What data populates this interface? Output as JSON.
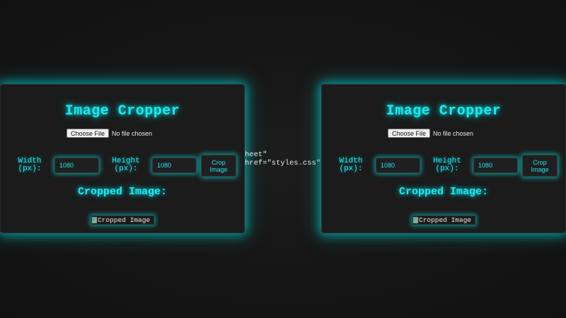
{
  "panels": [
    {
      "title": "Image Cropper",
      "file_button": "Choose File",
      "file_status": "No file chosen",
      "width_label_1": "Width",
      "width_label_2": "(px):",
      "width_value": "1080",
      "height_label_1": "Height",
      "height_label_2": "(px):",
      "height_value": "1080",
      "crop_button_1": "Crop",
      "crop_button_2": "Image",
      "subtitle": "Cropped Image:",
      "image_alt": "Cropped Image"
    },
    {
      "title": "Image Cropper",
      "file_button": "Choose File",
      "file_status": "No file chosen",
      "width_label_1": "Width",
      "width_label_2": "(px):",
      "width_value": "1080",
      "height_label_1": "Height",
      "height_label_2": "(px):",
      "height_value": "1080",
      "crop_button_1": "Crop",
      "crop_button_2": "Image",
      "subtitle": "Cropped Image:",
      "image_alt": "Cropped Image"
    }
  ],
  "stray_text": {
    "line1": "heet\"",
    "line2": "href=\"styles.css\">"
  },
  "colors": {
    "accent": "#1ee8ef",
    "background": "#141414",
    "panel": "#1b1b1b"
  },
  "icons": {
    "broken_image": "broken-image-icon"
  }
}
